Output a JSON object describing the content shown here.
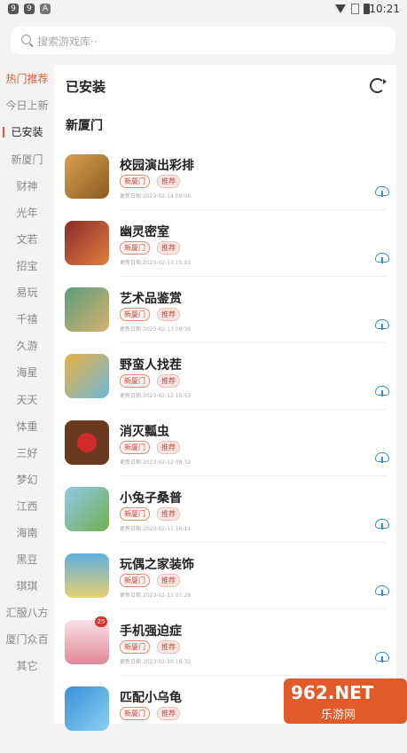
{
  "status": {
    "time": "10:21",
    "left_icons": [
      "9",
      "9",
      "A"
    ]
  },
  "search": {
    "placeholder": "搜索游戏库··"
  },
  "sidebar": {
    "items": [
      {
        "label": "热门推荐"
      },
      {
        "label": "今日上新"
      },
      {
        "label": "已安装"
      },
      {
        "label": "新厦门"
      },
      {
        "label": "财神"
      },
      {
        "label": "光年"
      },
      {
        "label": "文若"
      },
      {
        "label": "招宝"
      },
      {
        "label": "易玩"
      },
      {
        "label": "千禧"
      },
      {
        "label": "久游"
      },
      {
        "label": "海星"
      },
      {
        "label": "天天"
      },
      {
        "label": "体重"
      },
      {
        "label": "三好"
      },
      {
        "label": "梦幻"
      },
      {
        "label": "江西"
      },
      {
        "label": "海南"
      },
      {
        "label": "黑豆"
      },
      {
        "label": "琪琪"
      },
      {
        "label": "汇服八方"
      },
      {
        "label": "厦门众百"
      },
      {
        "label": "其它"
      }
    ]
  },
  "main": {
    "title": "已安装",
    "section": "新厦门"
  },
  "games": [
    {
      "name": "校园演出彩排",
      "tag1": "新厦门",
      "tag2": "推荐",
      "date": "更新日期:2023-02-14 09:06",
      "color1": "#b5781f",
      "color2": "#6aa04e"
    },
    {
      "name": "幽灵密室",
      "tag1": "新厦门",
      "tag2": "推荐",
      "date": "更新日期:2023-02-13 15:03",
      "color1": "#7a2a2a",
      "color2": "#d86a2a"
    },
    {
      "name": "艺术品鉴赏",
      "tag1": "新厦门",
      "tag2": "推荐",
      "date": "更新日期:2023-02-13 09:39",
      "color1": "#4a8f6a",
      "color2": "#c9a46a"
    },
    {
      "name": "野蛮人找茬",
      "tag1": "新厦门",
      "tag2": "推荐",
      "date": "更新日期:2023-02-12 15:53",
      "color1": "#e0a030",
      "color2": "#6ab0d0"
    },
    {
      "name": "消灭瓢虫",
      "tag1": "新厦门",
      "tag2": "推荐",
      "date": "更新日期:2023-02-12 08:32",
      "color1": "#6a3a20",
      "color2": "#c22a2a"
    },
    {
      "name": "小兔子桑普",
      "tag1": "新厦门",
      "tag2": "推荐",
      "date": "更新日期:2023-02-11 16:11",
      "color1": "#7ac060",
      "color2": "#8ab8e0"
    },
    {
      "name": "玩偶之家装饰",
      "tag1": "新厦门",
      "tag2": "推荐",
      "date": "更新日期:2023-02-11 07:28",
      "color1": "#60b0e0",
      "color2": "#e8d070"
    },
    {
      "name": "手机强迫症",
      "tag1": "新厦门",
      "tag2": "推荐",
      "date": "更新日期:2023-02-10 16:32",
      "color1": "#f0c0c8",
      "color2": "#d06080"
    },
    {
      "name": "匹配小乌龟",
      "tag1": "新厦门",
      "tag2": "推荐",
      "date": "",
      "color1": "#3a90d8",
      "color2": "#8ad0f0"
    }
  ],
  "watermark": {
    "top": "962.NET",
    "bottom": "乐游网"
  }
}
